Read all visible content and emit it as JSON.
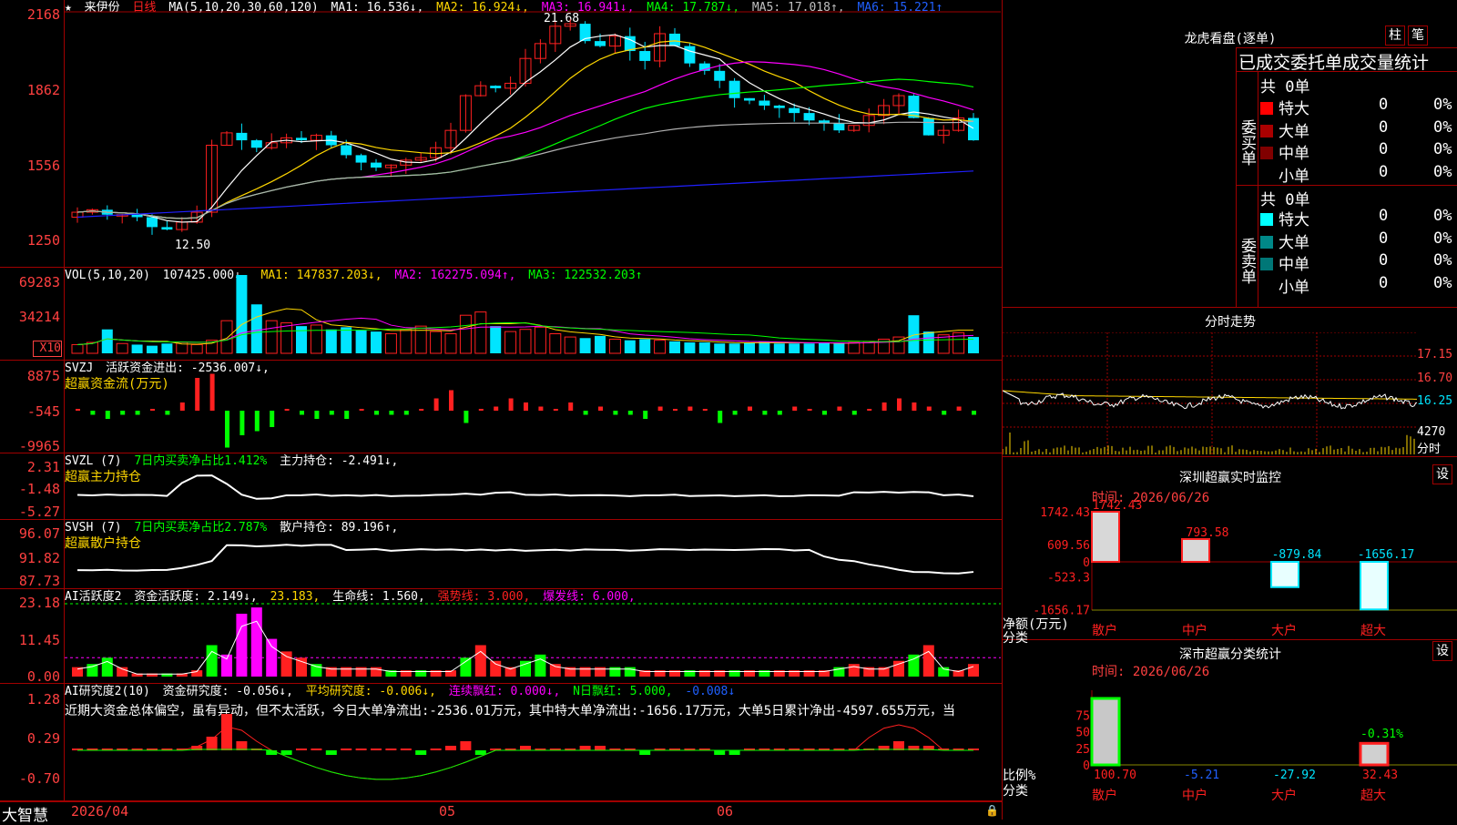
{
  "colors": {
    "up": "#ff2020",
    "down": "#00e5ff",
    "green": "#00ff00",
    "magenta": "#ff00ff",
    "yellow": "#ffd700",
    "white": "#ffffff",
    "blue": "#2020ff",
    "grid": "#a00000"
  },
  "header": {
    "stock_name": "来伊份",
    "period": "日线",
    "ma_label": "MA(5,10,20,30,60,120)",
    "ma1": "MA1: 16.536↓,",
    "ma2": "MA2: 16.924↓,",
    "ma3": "MA3: 16.941↓,",
    "ma4": "MA4: 17.787↓,",
    "ma5": "MA5: 17.018↑,",
    "ma6": "MA6: 15.221↑"
  },
  "price_panel": {
    "ticks": [
      "2168",
      "1862",
      "1556",
      "1250"
    ],
    "high_label": "21.68",
    "low_label": "12.50"
  },
  "vol_panel": {
    "label": "VOL(5,10,20)",
    "value": "107425.000↓,",
    "ma1": "MA1: 147837.203↓,",
    "ma2": "MA2: 162275.094↑,",
    "ma3": "MA3: 122532.203↑",
    "ticks": [
      "69283",
      "34214"
    ],
    "unit": "X10"
  },
  "svzj_panel": {
    "label": "SVZJ",
    "text": "活跃资金进出: -2536.007↓,",
    "subtitle": "超赢资金流(万元)",
    "ticks": [
      "8875",
      "-545",
      "-9965"
    ]
  },
  "svzl_panel": {
    "label": "SVZL (7)",
    "pct": "7日内买卖净占比1.412%",
    "text": "主力持仓: -2.491↓,",
    "subtitle": "超赢主力持仓",
    "ticks": [
      "2.31",
      "-1.48",
      "-5.27"
    ]
  },
  "svsh_panel": {
    "label": "SVSH (7)",
    "pct": "7日内买卖净占比2.787%",
    "text": "散户持仓: 89.196↑,",
    "subtitle": "超赢散户持仓",
    "ticks": [
      "96.07",
      "91.82",
      "87.73"
    ]
  },
  "ai1_panel": {
    "label": "AI活跃度2",
    "v1": "资金活跃度: 2.149↓,",
    "v2": "23.183,",
    "v3": "生命线: 1.560,",
    "v4": "强势线: 3.000,",
    "v5": "爆发线: 6.000,",
    "ticks": [
      "23.18",
      "11.45",
      "0.00"
    ]
  },
  "ai2_panel": {
    "label": "AI研究度2(10)",
    "v1": "资金研究度: -0.056↓,",
    "v2": "平均研究度: -0.006↓,",
    "v3": "连续飘红: 0.000↓,",
    "v4": "N日飘红: 5.000,",
    "v5": "-0.008↓",
    "comment": "近期大资金总体偏空，虽有异动，但不太活跃，今日大单净流出:-2536.01万元，其中特大单净流出:-1656.17万元，大单5日累计净出-4597.655万元，当",
    "ticks": [
      "1.28",
      "0.29",
      "-0.70"
    ]
  },
  "bottom": {
    "app": "大智慧",
    "date1": "2026/04",
    "m1": "05",
    "m2": "06"
  },
  "lhb": {
    "title": "龙虎看盘(逐单)",
    "btn1": "柱",
    "btn2": "笔",
    "subtitle": "已成交委托单成交量统计",
    "buy_label": "委买单",
    "sell_label": "委卖单",
    "buy_total": "共 0单",
    "sell_total": "共 0单",
    "buy_rows": [
      {
        "name": "特大",
        "val": "0",
        "pct": "0%",
        "color": "#ff0000"
      },
      {
        "name": "大单",
        "val": "0",
        "pct": "0%",
        "color": "#aa0000"
      },
      {
        "name": "中单",
        "val": "0",
        "pct": "0%",
        "color": "#800000"
      },
      {
        "name": "小单",
        "val": "0",
        "pct": "0%",
        "color": "#000"
      }
    ],
    "sell_rows": [
      {
        "name": "特大",
        "val": "0",
        "pct": "0%",
        "color": "#00ffff"
      },
      {
        "name": "大单",
        "val": "0",
        "pct": "0%",
        "color": "#008888"
      },
      {
        "name": "中单",
        "val": "0",
        "pct": "0%",
        "color": "#007777"
      },
      {
        "name": "小单",
        "val": "0",
        "pct": "0%",
        "color": "#000"
      }
    ]
  },
  "fenshi": {
    "title": "分时走势",
    "ticks": [
      "17.15",
      "16.70",
      "16.25",
      "4270"
    ],
    "label": "分时"
  },
  "monitor": {
    "title": "深圳超赢实时监控",
    "btn": "设",
    "time": "时间: 2026/06/26",
    "ticks": [
      "1742.43",
      "609.56",
      "0",
      "-523.3",
      "-1656.17"
    ],
    "ylabel": "净额(万元)",
    "xlabel": "分类",
    "cats": [
      "散户",
      "中户",
      "大户",
      "超大"
    ],
    "values": [
      1742.43,
      793.58,
      -879.84,
      -1656.17
    ],
    "labels": [
      "1742.43",
      "793.58",
      "-879.84",
      "-1656.17"
    ]
  },
  "stats": {
    "title": "深市超赢分类统计",
    "btn": "设",
    "time": "时间: 2026/06/26",
    "ticks": [
      "75",
      "50",
      "25",
      "0"
    ],
    "ylabel": "比例%",
    "xlabel": "分类",
    "cats": [
      "散户",
      "中户",
      "大户",
      "超大"
    ],
    "values": [
      "100.70",
      "-5.21",
      "-27.92",
      "32.43"
    ],
    "top_label": "-0.31%"
  }
}
